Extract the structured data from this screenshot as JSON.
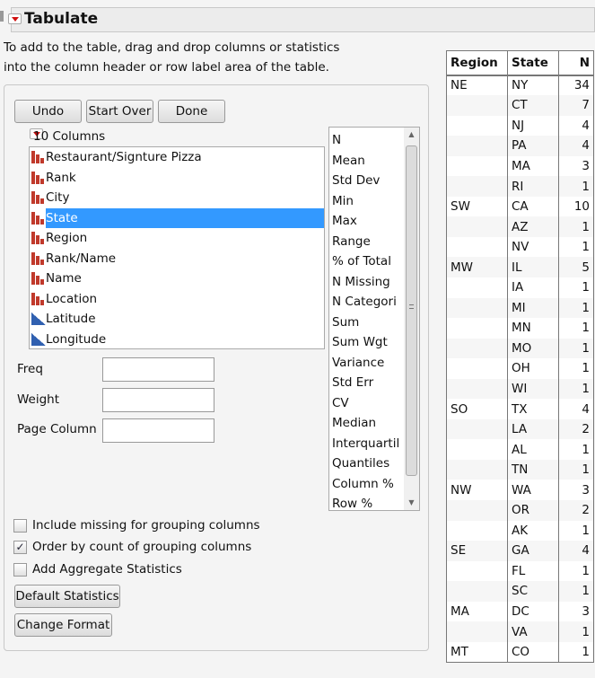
{
  "title": "Tabulate",
  "description": [
    "To add to the table, drag and drop columns or statistics",
    "into the column header or row label area of the table."
  ],
  "buttons": {
    "undo": "Undo",
    "start_over": "Start Over",
    "done": "Done",
    "default_statistics": "Default Statistics",
    "change_format": "Change Format"
  },
  "columns_header": "10 Columns",
  "columns": [
    {
      "name": "Restaurant/Signture Pizza",
      "type": "nominal"
    },
    {
      "name": "Rank",
      "type": "nominal"
    },
    {
      "name": "City",
      "type": "nominal"
    },
    {
      "name": "State",
      "type": "nominal",
      "selected": true
    },
    {
      "name": "Region",
      "type": "nominal"
    },
    {
      "name": "Rank/Name",
      "type": "nominal"
    },
    {
      "name": "Name",
      "type": "nominal"
    },
    {
      "name": "Location",
      "type": "nominal"
    },
    {
      "name": "Latitude",
      "type": "continuous"
    },
    {
      "name": "Longitude",
      "type": "continuous"
    }
  ],
  "statistics": [
    "N",
    "Mean",
    "Std Dev",
    "Min",
    "Max",
    "Range",
    "% of Total",
    "N Missing",
    "N Categori",
    "Sum",
    "Sum Wgt",
    "Variance",
    "Std Err",
    "CV",
    "Median",
    "Interquartil",
    "Quantiles",
    "Column %",
    "Row %"
  ],
  "fields": {
    "freq": "Freq",
    "weight": "Weight",
    "page_column": "Page Column"
  },
  "options": [
    {
      "label": "Include missing for grouping columns",
      "checked": false
    },
    {
      "label": "Order by count of grouping columns",
      "checked": true
    },
    {
      "label": "Add Aggregate Statistics",
      "checked": false
    }
  ],
  "result_table": {
    "headers": [
      "Region",
      "State",
      "N"
    ],
    "rows": [
      [
        "NE",
        "NY",
        "34"
      ],
      [
        "",
        "CT",
        "7"
      ],
      [
        "",
        "NJ",
        "4"
      ],
      [
        "",
        "PA",
        "4"
      ],
      [
        "",
        "MA",
        "3"
      ],
      [
        "",
        "RI",
        "1"
      ],
      [
        "SW",
        "CA",
        "10"
      ],
      [
        "",
        "AZ",
        "1"
      ],
      [
        "",
        "NV",
        "1"
      ],
      [
        "MW",
        "IL",
        "5"
      ],
      [
        "",
        "IA",
        "1"
      ],
      [
        "",
        "MI",
        "1"
      ],
      [
        "",
        "MN",
        "1"
      ],
      [
        "",
        "MO",
        "1"
      ],
      [
        "",
        "OH",
        "1"
      ],
      [
        "",
        "WI",
        "1"
      ],
      [
        "SO",
        "TX",
        "4"
      ],
      [
        "",
        "LA",
        "2"
      ],
      [
        "",
        "AL",
        "1"
      ],
      [
        "",
        "TN",
        "1"
      ],
      [
        "NW",
        "WA",
        "3"
      ],
      [
        "",
        "OR",
        "2"
      ],
      [
        "",
        "AK",
        "1"
      ],
      [
        "SE",
        "GA",
        "4"
      ],
      [
        "",
        "FL",
        "1"
      ],
      [
        "",
        "SC",
        "1"
      ],
      [
        "MA",
        "DC",
        "3"
      ],
      [
        "",
        "VA",
        "1"
      ],
      [
        "MT",
        "CO",
        "1"
      ]
    ]
  }
}
